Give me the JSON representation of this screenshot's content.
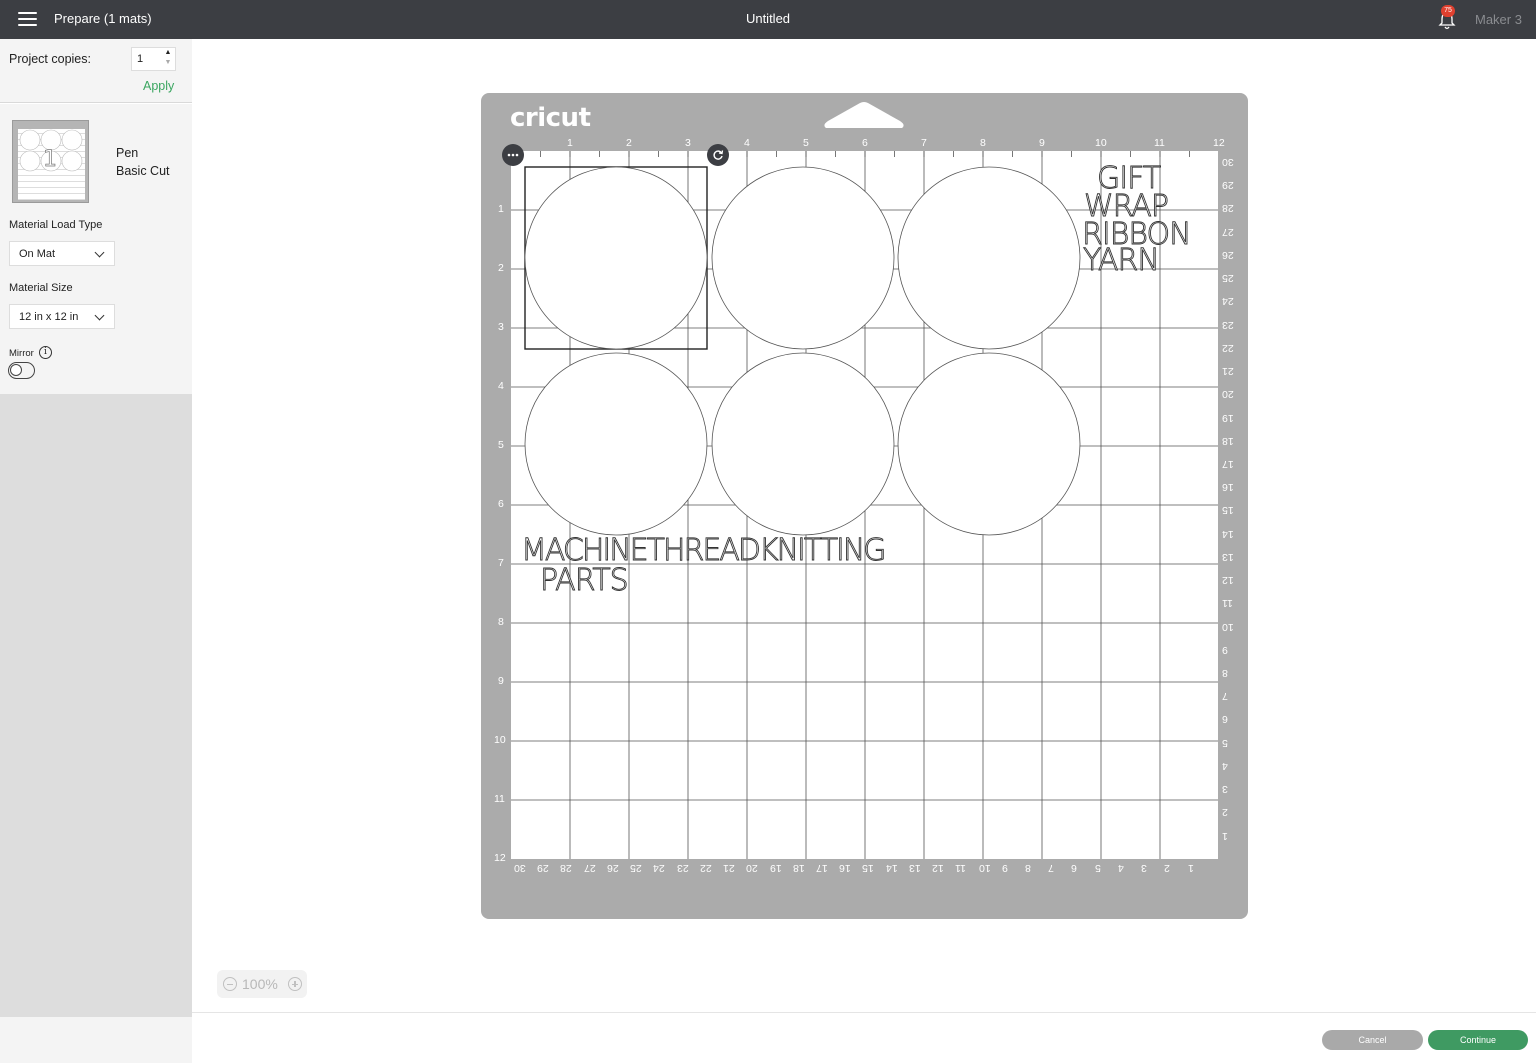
{
  "topbar": {
    "prepare_title": "Prepare (1 mats)",
    "document_title": "Untitled",
    "notification_count": "75",
    "machine_name": "Maker 3"
  },
  "left_panel": {
    "project_copies_label": "Project copies:",
    "project_copies_value": "1",
    "apply_label": "Apply",
    "mat": {
      "thumb_number": "1",
      "tool": "Pen",
      "cut_type": "Basic Cut"
    },
    "material_load_type_label": "Material Load Type",
    "material_load_type_value": "On Mat",
    "material_size_label": "Material Size",
    "material_size_value": "12 in x 12 in",
    "mirror_label": "Mirror",
    "mirror_on": false
  },
  "mat": {
    "brand": "cricut",
    "top_ruler": [
      "1",
      "2",
      "3",
      "4",
      "5",
      "6",
      "7",
      "8",
      "9",
      "10",
      "11",
      "12"
    ],
    "left_ruler": [
      "1",
      "2",
      "3",
      "4",
      "5",
      "6",
      "7",
      "8",
      "9",
      "10",
      "11",
      "12"
    ],
    "right_ruler_cm": [
      "30",
      "29",
      "28",
      "27",
      "26",
      "25",
      "24",
      "23",
      "22",
      "21",
      "20",
      "19",
      "18",
      "17",
      "16",
      "15",
      "14",
      "13",
      "12",
      "11",
      "10",
      "9",
      "8",
      "7",
      "6",
      "5",
      "4",
      "3",
      "2",
      "1"
    ],
    "bottom_ruler_cm": [
      "30",
      "29",
      "28",
      "27",
      "26",
      "25",
      "24",
      "23",
      "22",
      "21",
      "20",
      "19",
      "18",
      "17",
      "16",
      "15",
      "14",
      "13",
      "12",
      "11",
      "10",
      "9",
      "8",
      "7",
      "6",
      "5",
      "4",
      "3",
      "2",
      "1"
    ],
    "design_text_1": [
      "GIFT",
      "WRAP",
      "RIBBON",
      "YARN"
    ],
    "design_text_2": [
      "MACHINETHREADKNITTING",
      "PARTS"
    ]
  },
  "zoom": {
    "value": "100%"
  },
  "footer": {
    "cancel_label": "Cancel",
    "continue_label": "Continue"
  },
  "colors": {
    "topbar": "#3c3e43",
    "accent_green": "#3f9a62",
    "mat_gray": "#ababab",
    "badge_red": "#e0402f"
  }
}
